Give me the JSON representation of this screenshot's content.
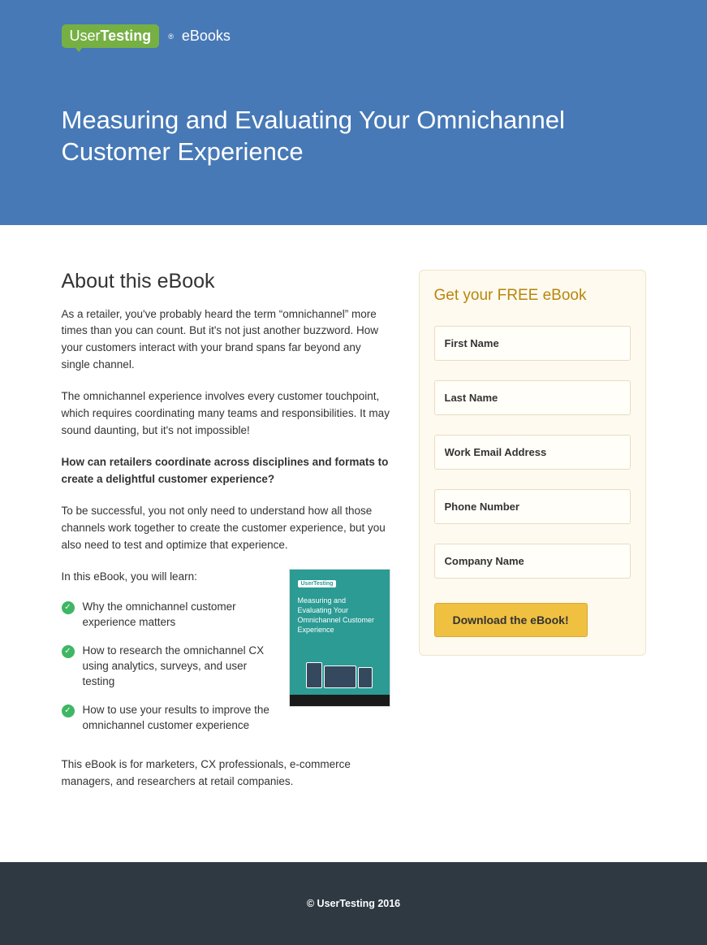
{
  "header": {
    "logo_user": "User",
    "logo_testing": "Testing",
    "logo_reg": "®",
    "logo_suffix": "eBooks",
    "title": "Measuring and Evaluating Your Omnichannel Customer Experience"
  },
  "about": {
    "heading": "About this eBook",
    "p1": "As a retailer, you've probably heard the term “omnichannel” more times than you can count. But it's not just another buzzword. How your customers interact with your brand spans far beyond any single channel.",
    "p2": "The omnichannel experience involves every customer touchpoint, which requires coordinating many teams and responsibilities. It may sound daunting, but it's not impossible!",
    "p3": "How can retailers coordinate across disciplines and formats to create a delightful customer experience?",
    "p4": "To be successful, you not only need to understand how all those channels work together to create the customer experience, but you also need to test and optimize that experience.",
    "learn_intro": "In this eBook, you will learn:",
    "bullets": [
      "Why the omnichannel customer experience matters",
      "How to research the omnichannel CX using analytics, surveys, and user testing",
      "How to use your results to improve the omnichannel customer experience"
    ],
    "closing": "This eBook is for marketers, CX professionals, e-commerce managers, and researchers at retail companies.",
    "cover_logo": "UserTesting",
    "cover_title": "Measuring and Evaluating Your Omnichannel Customer Experience"
  },
  "form": {
    "heading": "Get your FREE eBook",
    "first_name": "First Name",
    "last_name": "Last Name",
    "email": "Work Email Address",
    "phone": "Phone Number",
    "company": "Company Name",
    "submit": "Download the eBook!"
  },
  "footer": {
    "text": "© UserTesting 2016"
  }
}
